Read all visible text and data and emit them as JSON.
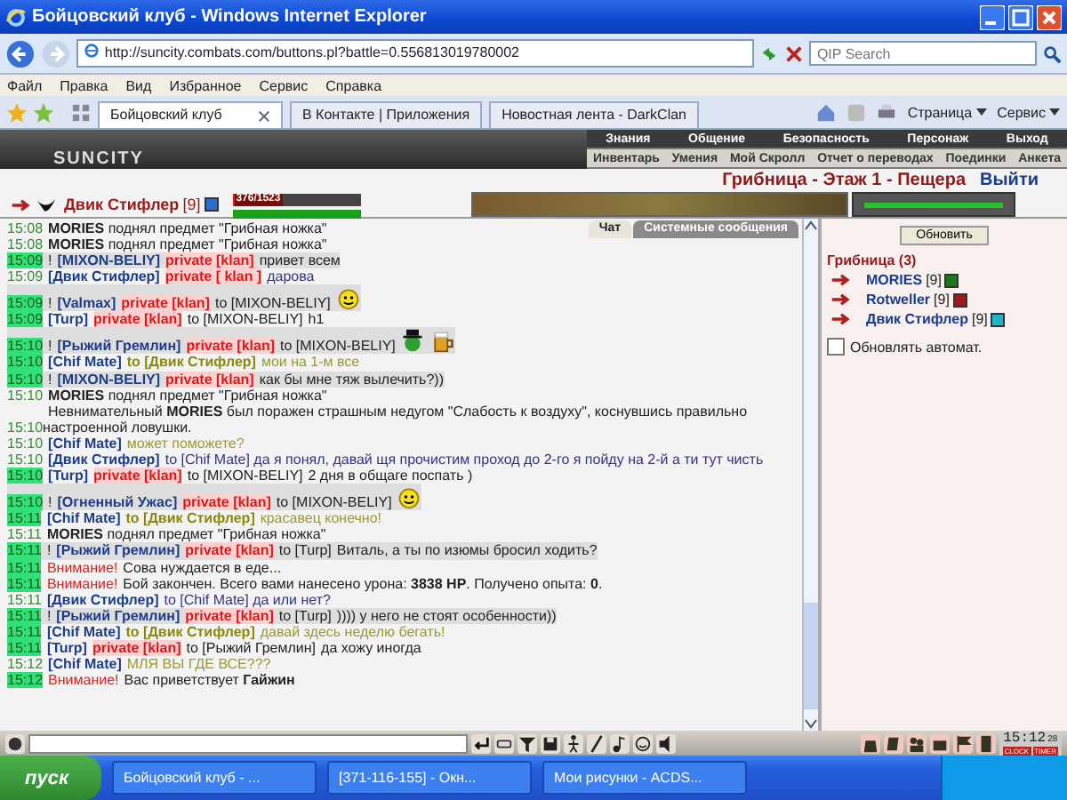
{
  "window": {
    "title": "Бойцовский клуб - Windows Internet Explorer"
  },
  "address_bar": {
    "url": "http://suncity.combats.com/buttons.pl?battle=0.556813019780002",
    "search_placeholder": "QIP Search"
  },
  "menu": [
    "Файл",
    "Правка",
    "Вид",
    "Избранное",
    "Сервис",
    "Справка"
  ],
  "tabs": [
    {
      "label": "Бойцовский клуб",
      "selected": true
    },
    {
      "label": "В Контакте | Приложения",
      "selected": false
    },
    {
      "label": "Новостная лента - DarkClan",
      "selected": false
    }
  ],
  "toolbar": [
    "Страница",
    "Сервис"
  ],
  "game": {
    "logo": "SUNCITY",
    "nav_top": [
      "Знания",
      "Общение",
      "Безопасность",
      "Персонаж",
      "Выход"
    ],
    "nav_bottom": [
      "Инвентарь",
      "Умения",
      "Мой Скролл",
      "Отчет о переводах",
      "Поединки",
      "Анкета"
    ],
    "location": "Грибница - Этаж 1 - Пещера",
    "exit": "Выйти",
    "player": {
      "name": "Двик Стифлер",
      "level": "[9]",
      "hp": {
        "reading": "376/1523",
        "level": 0.247
      },
      "mana": {
        "level": 1
      }
    }
  },
  "chat": {
    "tabs": [
      {
        "label": "Чат",
        "selected": true
      },
      {
        "label": "Системные сообщения",
        "selected": false
      }
    ],
    "messages": [
      {
        "time": "15:08",
        "new": false,
        "highlighted": false,
        "parts": [
          {
            "kind": "text",
            "text": "**MORIES** поднял предмет \"Грибная ножка\""
          }
        ]
      },
      {
        "time": "15:08",
        "new": false,
        "highlighted": false,
        "parts": [
          {
            "kind": "text",
            "text": "**MORIES** поднял предмет \"Грибная ножка\""
          }
        ]
      },
      {
        "time": "15:09",
        "new": true,
        "highlighted": true,
        "parts": [
          {
            "kind": "text",
            "text": "!"
          },
          {
            "kind": "name",
            "text": "[MIXON-BELIY]"
          },
          {
            "kind": "private",
            "text": "private [klan]"
          },
          {
            "kind": "text",
            "text": "привет всем"
          }
        ]
      },
      {
        "time": "15:09",
        "new": false,
        "highlighted": false,
        "parts": [
          {
            "kind": "name",
            "text": "[Двик Стифлер]"
          },
          {
            "kind": "private",
            "text": "private [ klan ]"
          },
          {
            "kind": "own_text",
            "text": "дарова"
          }
        ]
      },
      {
        "time": "15:09",
        "new": true,
        "highlighted": true,
        "parts": [
          {
            "kind": "text",
            "text": "!"
          },
          {
            "kind": "name",
            "text": "[Valmax]"
          },
          {
            "kind": "private",
            "text": "private [klan]"
          },
          {
            "kind": "recipient",
            "text": "to [MIXON-BELIY]"
          },
          {
            "kind": "smiley"
          }
        ]
      },
      {
        "time": "15:09",
        "new": true,
        "highlighted": false,
        "parts": [
          {
            "kind": "name",
            "text": "[Turp]"
          },
          {
            "kind": "private",
            "text": "private [klan]"
          },
          {
            "kind": "recipient",
            "text": "to [MIXON-BELIY]"
          },
          {
            "kind": "text",
            "text": "h1"
          }
        ]
      },
      {
        "time": "15:10",
        "new": true,
        "highlighted": true,
        "parts": [
          {
            "kind": "text",
            "text": "!"
          },
          {
            "kind": "name",
            "text": "[Рыжий Гремлин]"
          },
          {
            "kind": "private",
            "text": "private [klan]"
          },
          {
            "kind": "recipient",
            "text": "to [MIXON-BELIY]"
          },
          {
            "kind": "hat_smiley"
          },
          {
            "kind": "beer"
          }
        ]
      },
      {
        "time": "15:10",
        "new": true,
        "highlighted": false,
        "parts": [
          {
            "kind": "name",
            "text": "[Chif Mate]"
          },
          {
            "kind": "olive",
            "text": "to [Двик Стифлер]"
          },
          {
            "kind": "olive_text",
            "text": "мои на 1-м все"
          }
        ]
      },
      {
        "time": "15:10",
        "new": true,
        "highlighted": true,
        "parts": [
          {
            "kind": "text",
            "text": "!"
          },
          {
            "kind": "name",
            "text": "[MIXON-BELIY]"
          },
          {
            "kind": "private",
            "text": "private [klan]"
          },
          {
            "kind": "text",
            "text": "как бы мне тяж вылечить?))"
          }
        ]
      },
      {
        "time": "15:10",
        "new": false,
        "highlighted": false,
        "parts": [
          {
            "kind": "text",
            "text": "**MORIES** поднял предмет \"Грибная ножка\""
          }
        ]
      },
      {
        "time": "15:10",
        "new": false,
        "highlighted": false,
        "parts": [
          {
            "kind": "text",
            "text": "Невнимательный **MORIES** был поражен страшным недугом \"Слабость к воздуху\", коснувшись правильно настроенной ловушки."
          }
        ]
      },
      {
        "time": "15:10",
        "new": false,
        "highlighted": false,
        "parts": [
          {
            "kind": "name",
            "text": "[Chif Mate]"
          },
          {
            "kind": "olive_text",
            "text": "может поможете?"
          }
        ]
      },
      {
        "time": "15:10",
        "new": false,
        "highlighted": false,
        "parts": [
          {
            "kind": "name",
            "text": "[Двик Стифлер]"
          },
          {
            "kind": "own_text",
            "text": "to [Chif Mate] да я понял, давай щя прочистим проход до 2-го я пойду на 2-й а ти тут чисть"
          }
        ]
      },
      {
        "time": "15:10",
        "new": true,
        "highlighted": false,
        "parts": [
          {
            "kind": "name",
            "text": "[Turp]"
          },
          {
            "kind": "private",
            "text": "private [klan]"
          },
          {
            "kind": "recipient",
            "text": "to [MIXON-BELIY]"
          },
          {
            "kind": "text",
            "text": "2 дня в общаге поспать )"
          }
        ]
      },
      {
        "time": "15:10",
        "new": true,
        "highlighted": true,
        "parts": [
          {
            "kind": "text",
            "text": "!"
          },
          {
            "kind": "name",
            "text": "[Огненный Ужас]"
          },
          {
            "kind": "private",
            "text": "private [klan]"
          },
          {
            "kind": "recipient",
            "text": "to [MIXON-BELIY]"
          },
          {
            "kind": "smiley"
          }
        ]
      },
      {
        "time": "15:11",
        "new": true,
        "highlighted": false,
        "parts": [
          {
            "kind": "name",
            "text": "[Chif Mate]"
          },
          {
            "kind": "olive",
            "text": "to [Двик Стифлер]"
          },
          {
            "kind": "olive_text",
            "text": "красавец конечно!"
          }
        ]
      },
      {
        "time": "15:11",
        "new": false,
        "highlighted": false,
        "parts": [
          {
            "kind": "text",
            "text": "**MORIES** поднял предмет \"Грибная ножка\""
          }
        ]
      },
      {
        "time": "15:11",
        "new": true,
        "highlighted": true,
        "parts": [
          {
            "kind": "text",
            "text": "!"
          },
          {
            "kind": "name",
            "text": "[Рыжий Гремлин]"
          },
          {
            "kind": "private",
            "text": "private [klan]"
          },
          {
            "kind": "recipient",
            "text": "to [Turp]"
          },
          {
            "kind": "text",
            "text": "Виталь, а ты по изюмы бросил ходить?"
          }
        ]
      },
      {
        "time": "15:11",
        "new": true,
        "highlighted": false,
        "parts": [
          {
            "kind": "alert",
            "text": "Внимание!"
          },
          {
            "kind": "text",
            "text": "Сова нуждается в еде..."
          }
        ]
      },
      {
        "time": "15:11",
        "new": true,
        "highlighted": false,
        "parts": [
          {
            "kind": "alert",
            "text": "Внимание!"
          },
          {
            "kind": "text",
            "text": "Бой закончен. Всего вами нанесено урона: **3838 HP**. Получено опыта: **0**."
          }
        ]
      },
      {
        "time": "15:11",
        "new": false,
        "highlighted": false,
        "parts": [
          {
            "kind": "name",
            "text": "[Двик Стифлер]"
          },
          {
            "kind": "own_text",
            "text": "to [Chif Mate] да или нет?"
          }
        ]
      },
      {
        "time": "15:11",
        "new": true,
        "highlighted": true,
        "parts": [
          {
            "kind": "text",
            "text": "!"
          },
          {
            "kind": "name",
            "text": "[Рыжий Гремлин]"
          },
          {
            "kind": "private",
            "text": "private [klan]"
          },
          {
            "kind": "recipient",
            "text": "to [Turp]"
          },
          {
            "kind": "text",
            "text": ")))) у него не стоят особенности))"
          }
        ]
      },
      {
        "time": "15:11",
        "new": true,
        "highlighted": false,
        "parts": [
          {
            "kind": "name",
            "text": "[Chif Mate]"
          },
          {
            "kind": "olive",
            "text": "to [Двик Стифлер]"
          },
          {
            "kind": "olive_text",
            "text": "давай здесь неделю бегать!"
          }
        ]
      },
      {
        "time": "15:11",
        "new": true,
        "highlighted": false,
        "parts": [
          {
            "kind": "name",
            "text": "[Turp]"
          },
          {
            "kind": "private",
            "text": "private [klan]"
          },
          {
            "kind": "recipient",
            "text": "to [Рыжий Гремлин]"
          },
          {
            "kind": "text",
            "text": "да хожу иногда"
          }
        ]
      },
      {
        "time": "15:12",
        "new": false,
        "highlighted": false,
        "parts": [
          {
            "kind": "name",
            "text": "[Chif Mate]"
          },
          {
            "kind": "olive_text",
            "text": "МЛЯ ВЫ ГДЕ ВСЕ???"
          }
        ]
      },
      {
        "time": "15:12",
        "new": true,
        "highlighted": false,
        "parts": [
          {
            "kind": "alert",
            "text": "Внимание!"
          },
          {
            "kind": "text",
            "text": "Вас приветствует **Гайжин**"
          }
        ]
      }
    ]
  },
  "online": {
    "refresh": "Обновить",
    "room": "Грибница (3)",
    "users": [
      {
        "name": "MORIES",
        "level": "[9]",
        "color": "#1a7a1a"
      },
      {
        "name": "Rotweller",
        "level": "[9]",
        "color": "#a01818"
      },
      {
        "name": "Двик Стифлер",
        "level": "[9]",
        "color": "#20b4c8"
      }
    ],
    "auto_refresh": {
      "label": "Обновлять автомат.",
      "checked": false
    }
  },
  "clock": {
    "time": "15:12",
    "seconds": "28",
    "labels": [
      "CLOCK",
      "TIMER"
    ]
  },
  "taskbar": {
    "start": "пуск",
    "items": [
      "Бойцовский клуб - ...",
      "[371-116-155] - Окн...",
      "Мои рисунки - ACDS..."
    ]
  }
}
